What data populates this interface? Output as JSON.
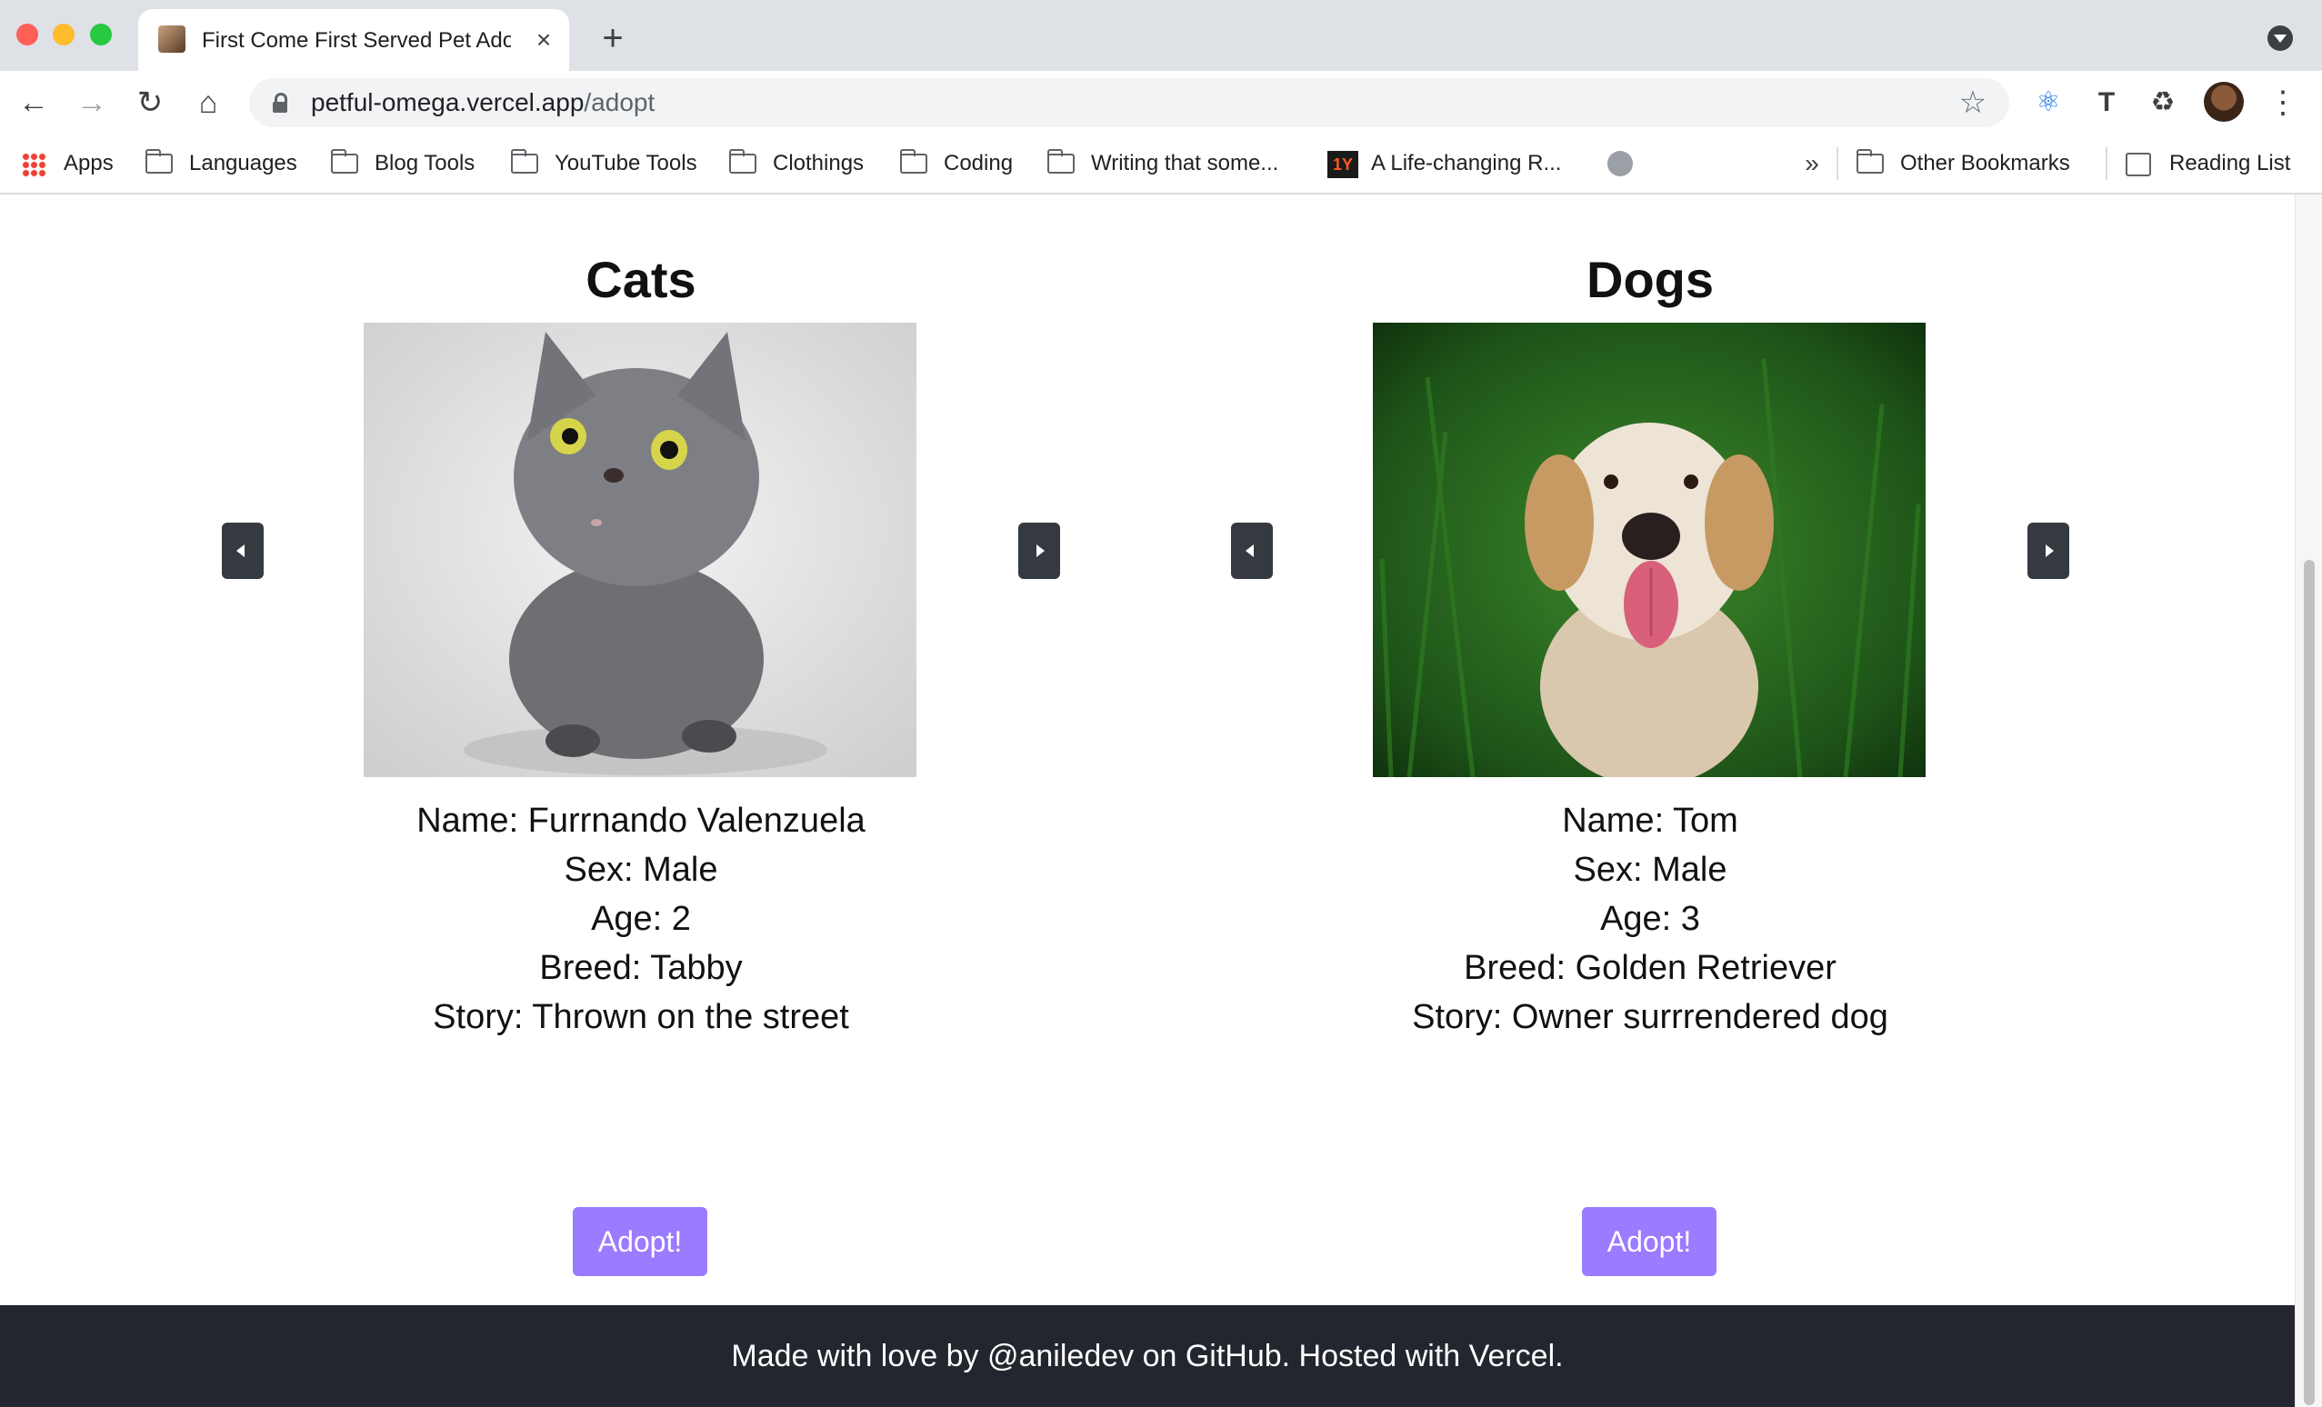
{
  "browser": {
    "tab_title": "First Come First Served Pet Adoption",
    "new_tab_symbol": "+",
    "close_symbol": "×",
    "url_host": "petful-omega.vercel.app",
    "url_path": "/adopt",
    "bookmarks": [
      "Apps",
      "Languages",
      "Blog Tools",
      "YouTube Tools",
      "Clothings",
      "Coding",
      "Writing that some...",
      "A Life-changing R..."
    ],
    "bookmark_more": "»",
    "other_bookmarks": "Other Bookmarks",
    "reading_list": "Reading List"
  },
  "cats": {
    "heading": "Cats",
    "name": "Name: Furrnando Valenzuela",
    "sex": "Sex: Male",
    "age": "Age: 2",
    "breed": "Breed: Tabby",
    "story": "Story: Thrown on the street",
    "adopt_label": "Adopt!"
  },
  "dogs": {
    "heading": "Dogs",
    "name": "Name: Tom",
    "sex": "Sex: Male",
    "age": "Age: 3",
    "breed": "Breed: Golden Retriever",
    "story": "Story: Owner surrrendered dog",
    "adopt_label": "Adopt!"
  },
  "footer": {
    "text": "Made with love by @aniledev on GitHub. Hosted with Vercel."
  },
  "colors": {
    "adopt_button": "#9b7bff",
    "footer_bg": "#23262e",
    "arrow_button": "#343a40"
  }
}
